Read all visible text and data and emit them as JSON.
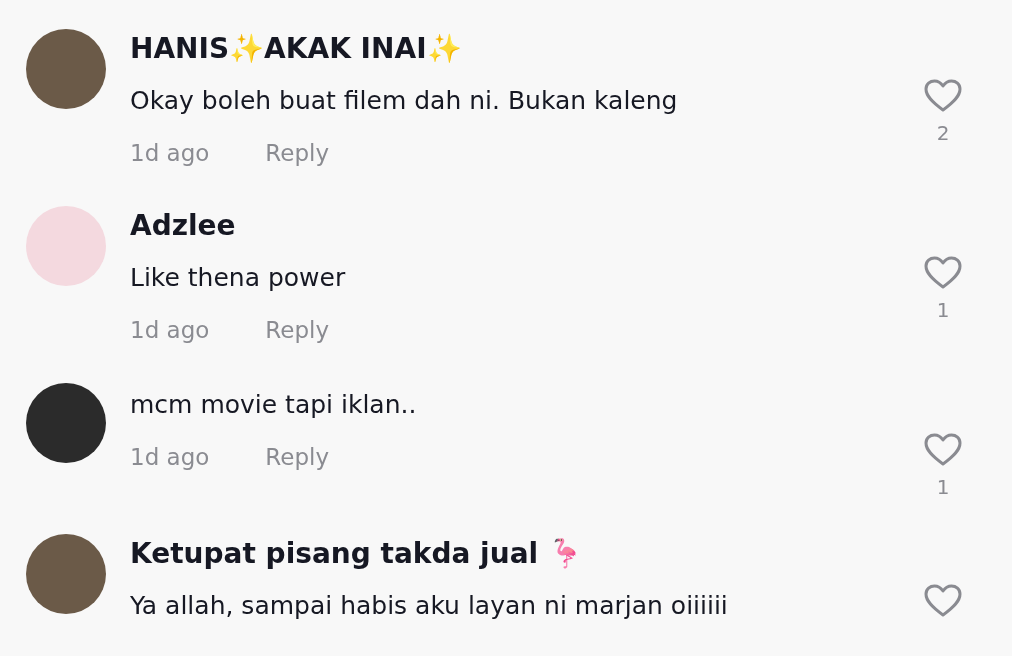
{
  "comments": [
    {
      "author": "HANIS✨AKAK INAI✨",
      "text": "Okay boleh buat filem dah ni. Bukan kaleng",
      "time": "1d ago",
      "reply": "Reply",
      "likes": "2",
      "avatar": {
        "kind": "photo"
      }
    },
    {
      "author": "Adzlee",
      "text": "Like thena power",
      "time": "1d ago",
      "reply": "Reply",
      "likes": "1",
      "avatar": {
        "kind": "cartoon"
      }
    },
    {
      "text": "mcm movie tapi iklan..",
      "time": "1d ago",
      "reply": "Reply",
      "likes": "1",
      "avatar": {
        "kind": "dark"
      }
    },
    {
      "author": "Ketupat pisang takda jual 🦩",
      "text": "Ya allah, sampai habis aku layan ni marjan oiiiiii",
      "avatar": {
        "kind": "photo"
      }
    }
  ]
}
